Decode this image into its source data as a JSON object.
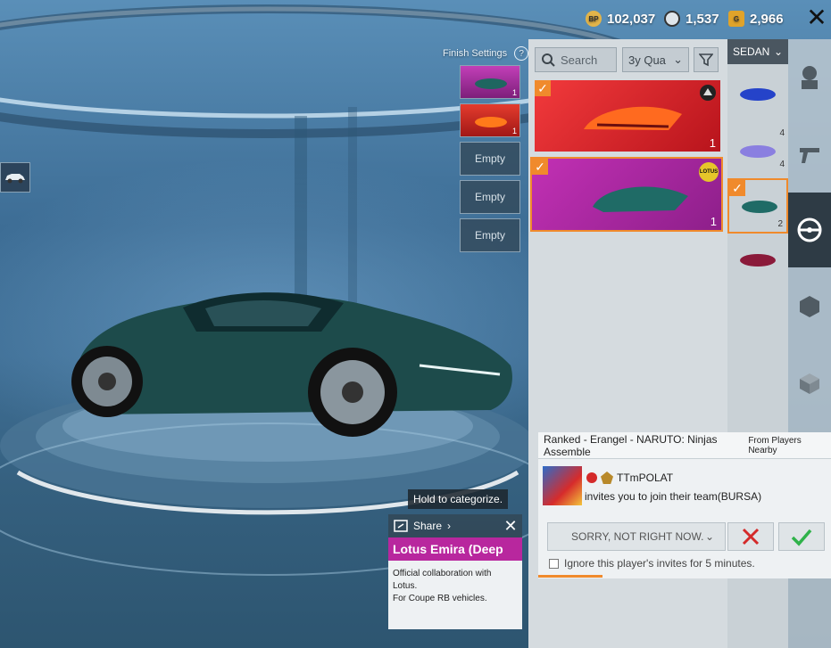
{
  "currency": {
    "bp": {
      "icon": "bp-coin-icon",
      "badge": "BP",
      "value": "102,037"
    },
    "silver": {
      "icon": "silver-fragment-icon",
      "value": "1,537"
    },
    "gold": {
      "icon": "gold-g-coin-icon",
      "badge": "G",
      "value": "2,966"
    }
  },
  "finish": {
    "label": "Finish Settings",
    "help": "?",
    "slot1_count": "1",
    "slot2_count": "1",
    "empty_label": "Empty"
  },
  "filter": {
    "search_placeholder": "Search",
    "sort_value": "3y Qua",
    "category": "SEDAN"
  },
  "skins": [
    {
      "name": "red-sports-car",
      "count": "1",
      "bg": "#e2262e"
    },
    {
      "name": "teal-lotus-emira",
      "count": "1",
      "bg": "#a8239c",
      "brand": "LOTUS"
    }
  ],
  "vehicle_types": [
    {
      "count": "4"
    },
    {
      "count": "4"
    },
    {
      "count": "2"
    },
    {
      "count": ""
    }
  ],
  "share": {
    "tooltip": "Hold to categorize.",
    "label": "Share"
  },
  "item": {
    "title": "Lotus Emira (Deep",
    "desc_line1": "Official collaboration with Lotus.",
    "desc_line2": "For Coupe RB vehicles."
  },
  "invite": {
    "mode": "Ranked - Erangel - NARUTO: Ninjas Assemble",
    "source": "From Players Nearby",
    "player": "TTmPOLAT",
    "message": "invites you to join their team(BURSA)",
    "decline_option": "SORRY, NOT RIGHT NOW.",
    "ignore_text": "Ignore this player's invites for 5 minutes.",
    "progress": 0.22
  },
  "colors": {
    "accent": "#f08a2c",
    "item_title_bg": "#b8279e",
    "decline_red": "#d42a2a",
    "accept_green": "#2fb24a"
  }
}
